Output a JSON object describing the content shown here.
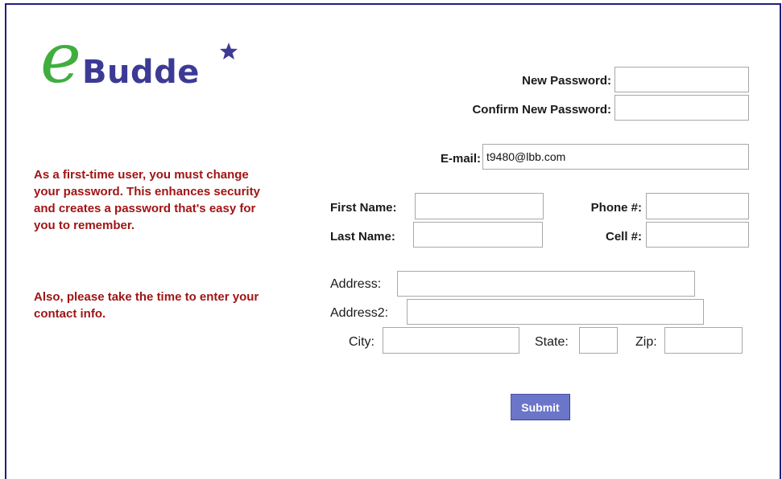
{
  "brand": {
    "logo_letter": "e",
    "logo_text": "Budde",
    "colors": {
      "letter": "#3fae3f",
      "text": "#3d3a96",
      "star": "#3d3a96"
    }
  },
  "intro": {
    "paragraph1": "As a first-time user, you must change your password. This enhances security and creates a password that's easy for you to remember.",
    "paragraph2": "Also, please take the time to enter your contact info.",
    "color": "#a01515"
  },
  "form": {
    "new_password": {
      "label": "New Password:",
      "value": ""
    },
    "confirm_password": {
      "label": "Confirm New Password:",
      "value": ""
    },
    "email": {
      "label": "E-mail:",
      "value": "t9480@lbb.com"
    },
    "first_name": {
      "label": "First Name:",
      "value": ""
    },
    "last_name": {
      "label": "Last Name:",
      "value": ""
    },
    "phone": {
      "label": "Phone #:",
      "value": ""
    },
    "cell": {
      "label": "Cell #:",
      "value": ""
    },
    "address": {
      "label": "Address:",
      "value": ""
    },
    "address2": {
      "label": "Address2:",
      "value": ""
    },
    "city": {
      "label": "City:",
      "value": ""
    },
    "state": {
      "label": "State:",
      "value": ""
    },
    "zip": {
      "label": "Zip:",
      "value": ""
    },
    "submit_label": "Submit"
  }
}
